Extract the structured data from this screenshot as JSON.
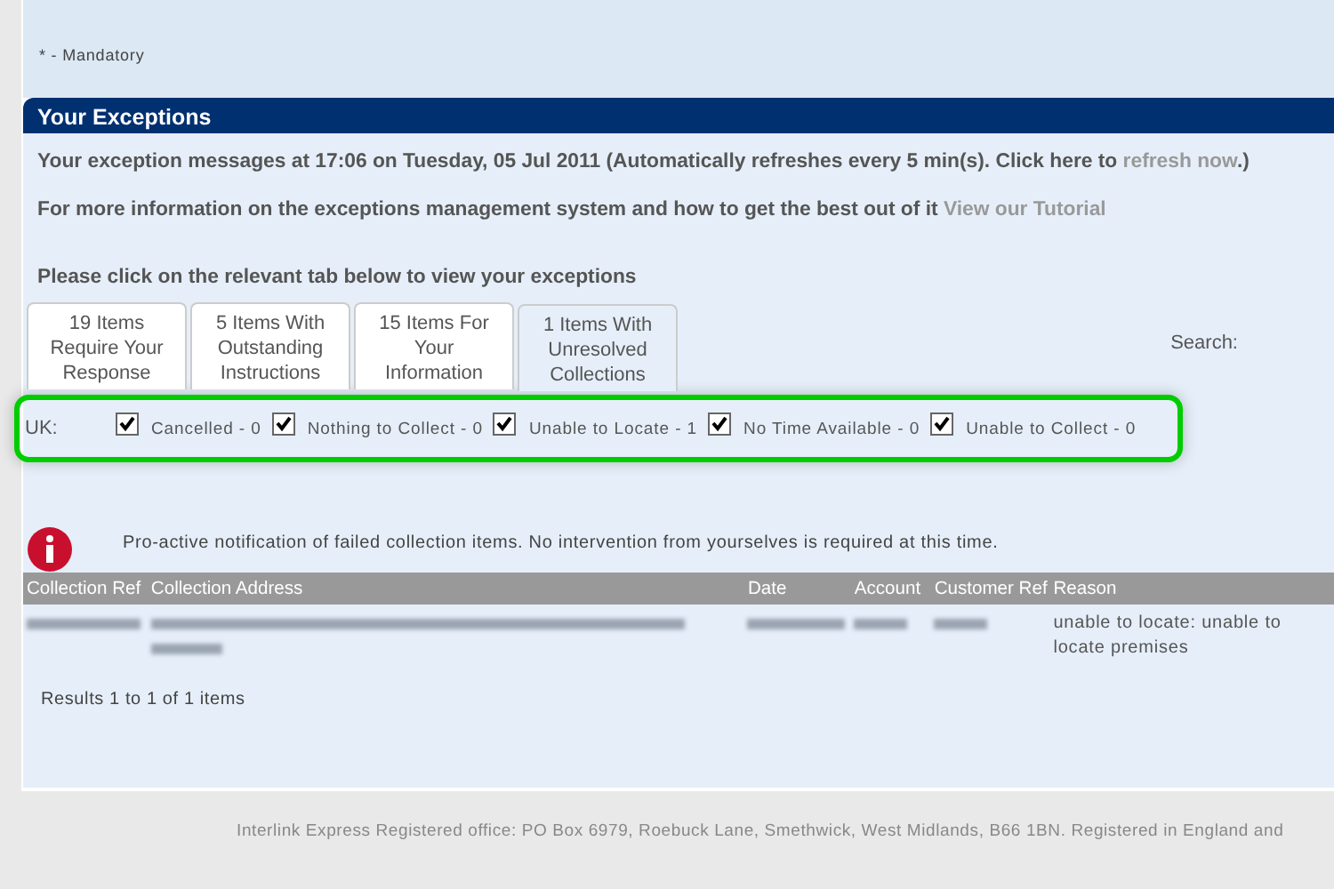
{
  "mandatory_note": "* - Mandatory",
  "section": {
    "title": "Your Exceptions"
  },
  "messages": [
    {
      "text": "Your exception messages at 17:06 on Tuesday, 05 Jul 2011 (Automatically refreshes every 5 min(s). Click here to ",
      "link": "refresh now",
      "after": ".)"
    },
    {
      "text": "For more information on the exceptions management system and how to get the best out of it ",
      "link": "View our Tutorial"
    }
  ],
  "instruction": "Please click on the relevant tab below to view your exceptions",
  "tabs": [
    {
      "label": "19 Items Require Your Response",
      "selected": false
    },
    {
      "label": "5 Items With Outstanding Instructions",
      "selected": false
    },
    {
      "label": "15 Items For Your Information",
      "selected": false
    },
    {
      "label": "1 Items With Unresolved Collections",
      "selected": true
    }
  ],
  "search_label": "Search:",
  "filter": {
    "label": "UK:",
    "options": [
      {
        "label": "Cancelled - 0",
        "checked": true
      },
      {
        "label": "Nothing to Collect - 0",
        "checked": true
      },
      {
        "label": "Unable to Locate - 1",
        "checked": true
      },
      {
        "label": "No Time Available - 0",
        "checked": true
      },
      {
        "label": "Unable to Collect - 0",
        "checked": true
      }
    ]
  },
  "notice": "Pro-active notification of failed collection items. No intervention from yourselves is required at this time.",
  "table": {
    "columns": [
      "Collection Ref",
      "Collection Address",
      "Date",
      "Account",
      "Customer Ref",
      "Reason"
    ],
    "rows": [
      {
        "cells": [
          {
            "redacted": true
          },
          {
            "redacted": true
          },
          {
            "redacted": true
          },
          {
            "redacted": true
          },
          {
            "redacted": true
          },
          {
            "redacted": false,
            "text": "unable to locate: unable to locate premises"
          }
        ]
      }
    ]
  },
  "results": "Results 1 to 1 of 1 items",
  "footer": "Interlink Express Registered office: PO Box 6979, Roebuck Lane, Smethwick, West Midlands, B66 1BN. Registered in England and"
}
